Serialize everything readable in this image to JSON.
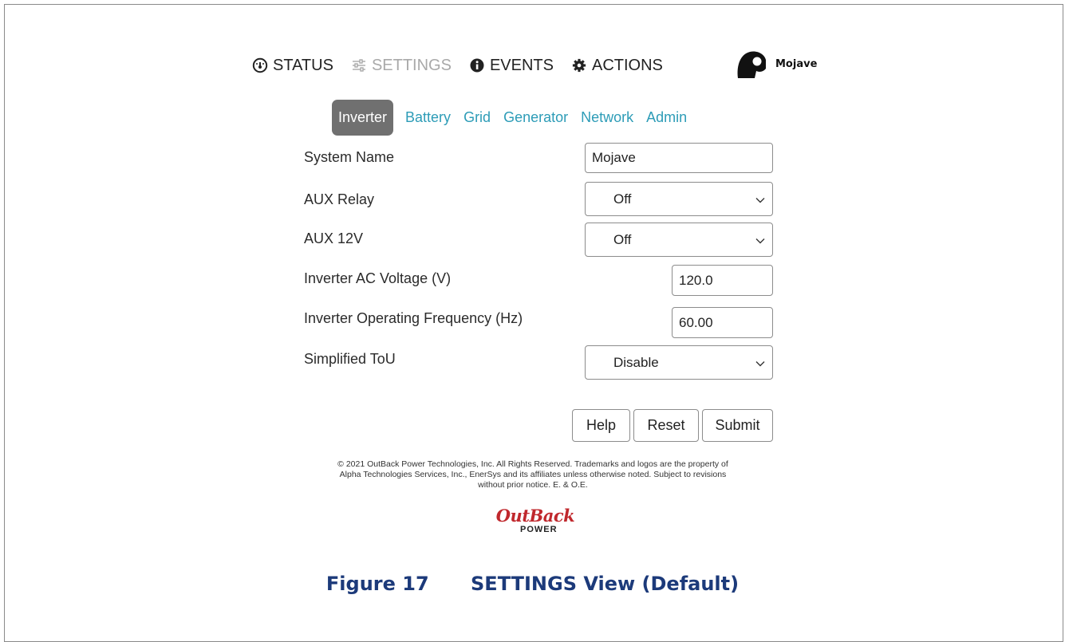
{
  "nav": {
    "items": [
      {
        "label": "STATUS",
        "icon": "gauge-icon",
        "active": false
      },
      {
        "label": "SETTINGS",
        "icon": "sliders-icon",
        "active": true
      },
      {
        "label": "EVENTS",
        "icon": "info-icon",
        "active": false
      },
      {
        "label": "ACTIONS",
        "icon": "gear-icon",
        "active": false
      }
    ],
    "user_name": "Mojave"
  },
  "tabs": [
    {
      "label": "Inverter",
      "active": true
    },
    {
      "label": "Battery",
      "active": false
    },
    {
      "label": "Grid",
      "active": false
    },
    {
      "label": "Generator",
      "active": false
    },
    {
      "label": "Network",
      "active": false
    },
    {
      "label": "Admin",
      "active": false
    }
  ],
  "form": {
    "system_name": {
      "label": "System Name",
      "value": "Mojave"
    },
    "aux_relay": {
      "label": "AUX Relay",
      "value": "Off"
    },
    "aux_12v": {
      "label": "AUX 12V",
      "value": "Off"
    },
    "ac_voltage": {
      "label": "Inverter AC Voltage (V)",
      "value": "120.0"
    },
    "frequency": {
      "label": "Inverter Operating Frequency (Hz)",
      "value": "60.00"
    },
    "tou": {
      "label": "Simplified ToU",
      "value": "Disable"
    }
  },
  "buttons": {
    "help": "Help",
    "reset": "Reset",
    "submit": "Submit"
  },
  "footer": {
    "line1": "© 2021 OutBack Power Technologies, Inc. All Rights Reserved. Trademarks and logos are the property of",
    "line2": "Alpha Technologies Services, Inc., EnerSys and its affiliates unless otherwise noted. Subject to revisions",
    "line3": "without prior notice. E. & O.E."
  },
  "logo": {
    "line1": "OutBack",
    "line2": "POWER"
  },
  "caption": {
    "number": "Figure 17",
    "title": "SETTINGS View (Default)"
  },
  "colors": {
    "tab_link": "#2d9cb7",
    "tab_active_bg": "#707070",
    "logo_red": "#c0282d",
    "caption_blue": "#1c3a7a"
  }
}
